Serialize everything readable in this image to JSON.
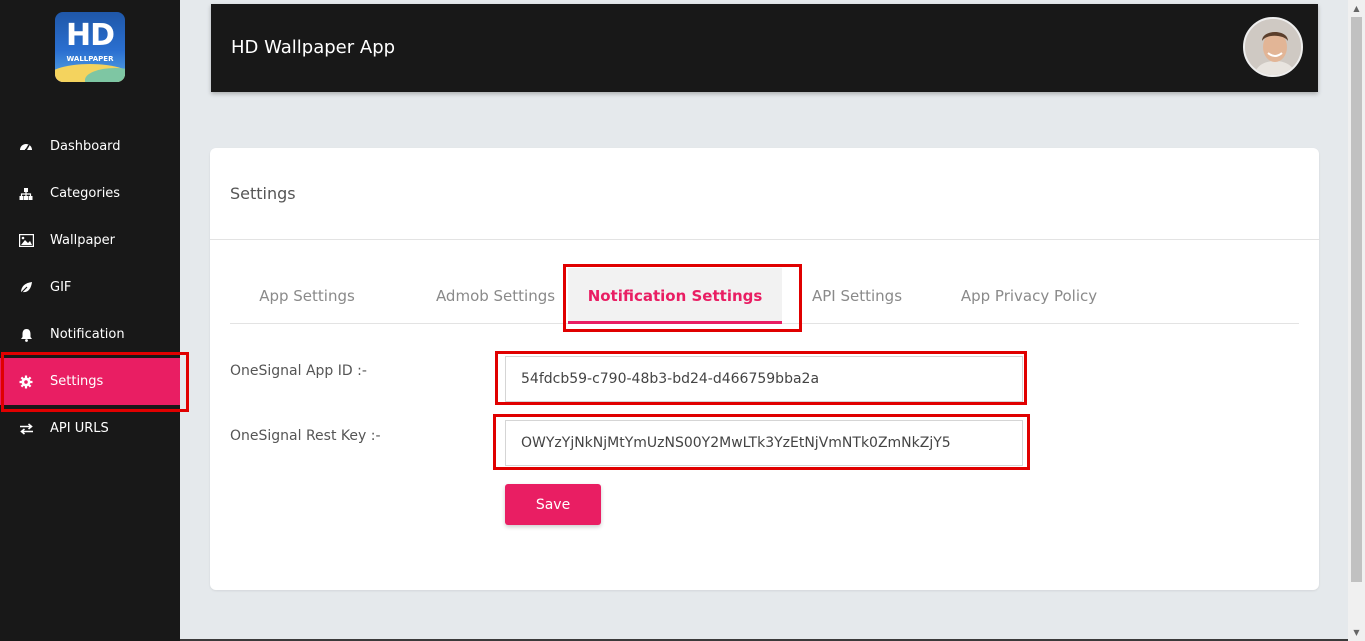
{
  "app": {
    "title": "HD Wallpaper App",
    "logo_text": "HD",
    "logo_subtext": "WALLPAPER"
  },
  "sidebar": {
    "items": [
      {
        "label": "Dashboard",
        "icon": "dashboard-icon"
      },
      {
        "label": "Categories",
        "icon": "sitemap-icon"
      },
      {
        "label": "Wallpaper",
        "icon": "image-icon"
      },
      {
        "label": "GIF",
        "icon": "leaf-icon"
      },
      {
        "label": "Notification",
        "icon": "bell-icon"
      },
      {
        "label": "Settings",
        "icon": "gear-icon",
        "active": true
      },
      {
        "label": "API URLS",
        "icon": "exchange-icon"
      }
    ]
  },
  "page": {
    "title": "Settings",
    "tabs": [
      {
        "label": "App Settings"
      },
      {
        "label": "Admob Settings"
      },
      {
        "label": "Notification Settings",
        "active": true
      },
      {
        "label": "API Settings"
      },
      {
        "label": "App Privacy Policy"
      }
    ],
    "form": {
      "app_id_label": "OneSignal App ID :-",
      "app_id_value": "54fdcb59-c790-48b3-bd24-d466759bba2a",
      "rest_key_label": "OneSignal Rest Key :-",
      "rest_key_value": "OWYzYjNkNjMtYmUzNS00Y2MwLTk3YzEtNjVmNTk0ZmNkZjY5",
      "save_label": "Save"
    }
  },
  "colors": {
    "accent": "#e91e63",
    "sidebar_bg": "#181818",
    "page_bg": "#e5e9ec",
    "highlight": "#e00000"
  }
}
